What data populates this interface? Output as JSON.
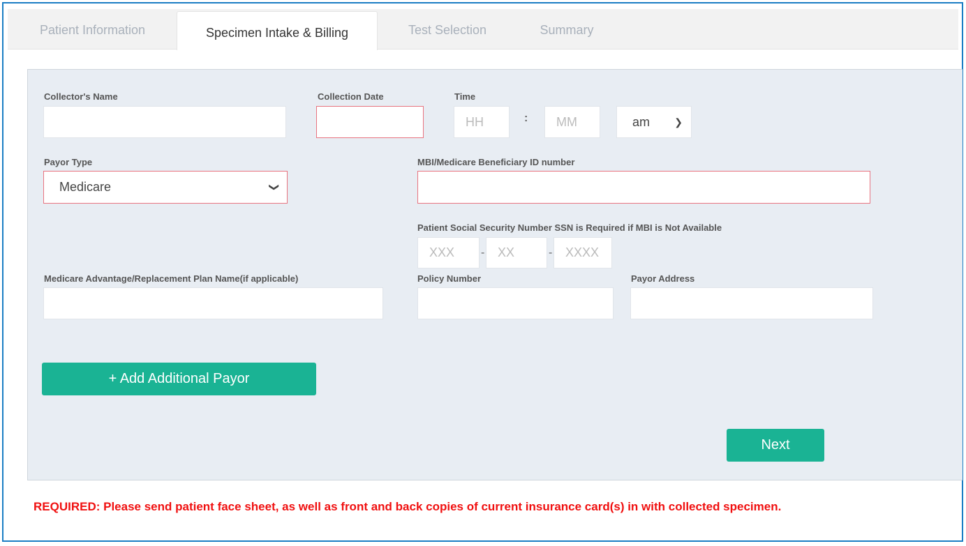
{
  "tabs": [
    {
      "label": "Patient Information",
      "active": false
    },
    {
      "label": "Specimen Intake & Billing",
      "active": true
    },
    {
      "label": "Test Selection",
      "active": false
    },
    {
      "label": "Summary",
      "active": false
    }
  ],
  "form": {
    "collector_name": {
      "label": "Collector's Name",
      "value": ""
    },
    "collection_date": {
      "label": "Collection Date",
      "value": ""
    },
    "time": {
      "label": "Time",
      "hh_placeholder": "HH",
      "separator": ":",
      "mm_placeholder": "MM",
      "ampm": "am"
    },
    "payor_type": {
      "label": "Payor Type",
      "value": "Medicare"
    },
    "mbi": {
      "label": "MBI/Medicare Beneficiary ID number",
      "value": ""
    },
    "ssn": {
      "label": "Patient Social Security Number SSN is Required if MBI is Not Available",
      "p1": "XXX",
      "p2": "XX",
      "p3": "XXXX",
      "dash": "-"
    },
    "plan_name": {
      "label": "Medicare Advantage/Replacement Plan Name(if applicable)",
      "value": ""
    },
    "policy_number": {
      "label": "Policy Number",
      "value": ""
    },
    "payor_address": {
      "label": "Payor Address",
      "value": ""
    }
  },
  "buttons": {
    "add_payor": "+ Add Additional Payor",
    "next": "Next"
  },
  "notice": "REQUIRED: Please send patient face sheet, as well as front and back copies of current insurance card(s) in with collected specimen.",
  "colors": {
    "accent": "#1ab394",
    "error_border": "#e8737f",
    "notice": "#f01010",
    "frame": "#1a7dc4"
  }
}
